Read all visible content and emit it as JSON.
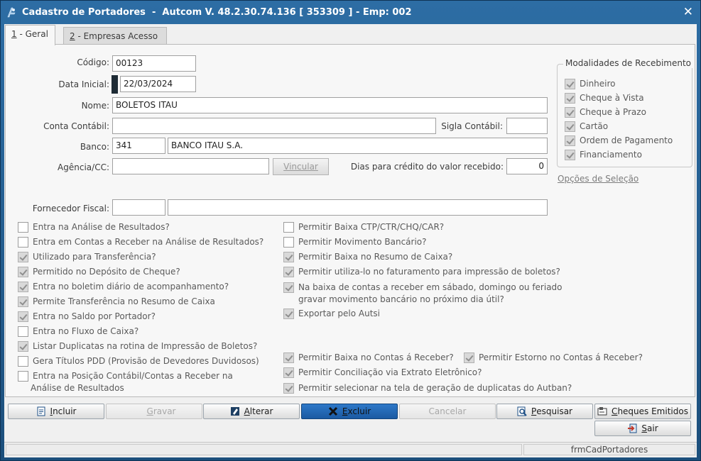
{
  "window": {
    "title": "Cadastro de Portadores  -  Autcom V. 48.2.30.74.136 [ 353309 ] - Emp: 002",
    "close_glyph": "✕"
  },
  "tabs": [
    {
      "num": "1",
      "label": " - Geral"
    },
    {
      "num": "2",
      "label": " - Empresas Acesso"
    }
  ],
  "form": {
    "codigo_label": "Código:",
    "codigo_value": "00123",
    "data_inicial_label": "Data Inicial:",
    "data_inicial_value": "22/03/2024",
    "nome_label": "Nome:",
    "nome_value": "BOLETOS ITAU",
    "conta_contabil_label": "Conta Contábil:",
    "conta_contabil_value": "",
    "sigla_contabil_label": "Sigla Contábil:",
    "sigla_contabil_value": "",
    "banco_label": "Banco:",
    "banco_code": "341",
    "banco_name": "BANCO ITAU S.A.",
    "agencia_label": "Agência/CC:",
    "agencia_value": "",
    "vincular_label": "Vincular",
    "dias_label": "Dias para crédito do valor recebido:",
    "dias_value": "0",
    "fornecedor_label": "Fornecedor Fiscal:",
    "fornecedor_code": "",
    "fornecedor_name": ""
  },
  "modalidades": {
    "title": "Modalidades de Recebimento",
    "items": [
      "Dinheiro",
      "Cheque à Vista",
      "Cheque à Prazo",
      "Cartão",
      "Ordem de Pagamento",
      "Financiamento"
    ],
    "link": "Opções de Seleção"
  },
  "left_checks": [
    {
      "label": "Entra na Análise de Resultados?",
      "checked": false
    },
    {
      "label": "Entra em Contas a Receber na Análise de Resultados?",
      "checked": false
    },
    {
      "label": "Utilizado para Transferência?",
      "checked": true
    },
    {
      "label": "Permitido no Depósito de Cheque?",
      "checked": true
    },
    {
      "label": "Entra no boletim diário de acompanhamento?",
      "checked": true
    },
    {
      "label": "Permite Transferência no Resumo de Caixa",
      "checked": true
    },
    {
      "label": "Entra no Saldo por Portador?",
      "checked": true
    },
    {
      "label": "Entra no Fluxo de Caixa?",
      "checked": false
    },
    {
      "label": "Listar Duplicatas na rotina de Impressão de Boletos?",
      "checked": true
    },
    {
      "label": "Gera Títulos PDD (Provisão de Devedores Duvidosos)",
      "checked": false
    },
    {
      "label": "Entra na Posição Contábil/Contas a Receber na",
      "label2": "Análise de Resultados",
      "checked": false
    }
  ],
  "right_checks": [
    {
      "label": "Permitir Baixa CTP/CTR/CHQ/CAR?",
      "checked": false
    },
    {
      "label": "Permitir Movimento Bancário?",
      "checked": false
    },
    {
      "label": "Permitir Baixa no Resumo de Caixa?",
      "checked": true
    },
    {
      "label": "Permitir utiliza-lo no faturamento para impressão de boletos?",
      "checked": true
    },
    {
      "label": "Na baixa de contas a receber em sábado, domingo ou feriado",
      "label2": "gravar movimento bancário no próximo dia útil?",
      "checked": true
    },
    {
      "label": "Exportar pelo Autsi",
      "checked": true
    }
  ],
  "bottom_checks": [
    {
      "label": "Permitir Baixa no Contas á Receber?",
      "checked": true
    },
    {
      "label": "Permitir Estorno no Contas á Receber?",
      "checked": true
    },
    {
      "label": "Permitir Conciliação via Extrato Eletrônico?",
      "checked": true
    },
    {
      "label": "Permitir selecionar na tela de geração de duplicatas do Autban?",
      "checked": true
    }
  ],
  "toolbar": {
    "incluir_u": "I",
    "incluir_rest": "ncluir",
    "gravar_u": "G",
    "gravar_rest": "ravar",
    "alterar_u": "A",
    "alterar_rest": "lterar",
    "excluir_u": "E",
    "excluir_rest": "xcluir",
    "cancelar": "Cancelar",
    "pesquisar_u": "P",
    "pesquisar_rest": "esquisar",
    "cheques_u": "C",
    "cheques_rest": "heques Emitidos",
    "sair_u": "S",
    "sair_rest": "air"
  },
  "status": {
    "form_name": "frmCadPortadores"
  },
  "colors": {
    "title_bar": "#1e5a8e",
    "excluir_button": "#1f64b0",
    "panel": "#f7f7f7"
  }
}
